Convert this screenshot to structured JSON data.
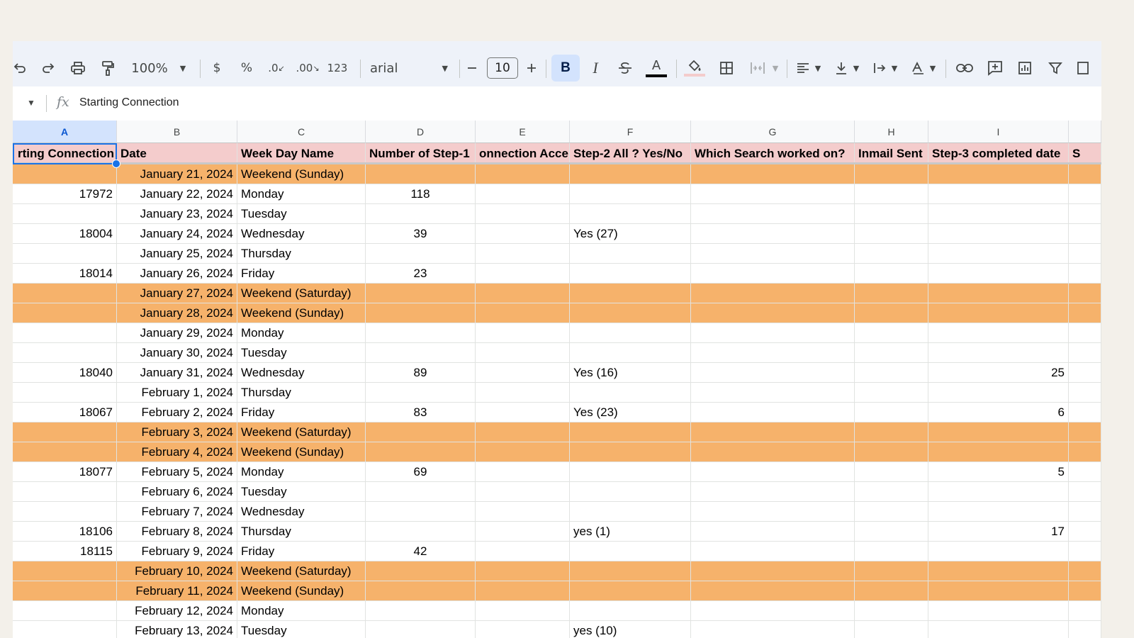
{
  "toolbar": {
    "zoom": "100%",
    "currency": "$",
    "percent": "%",
    "dec_decrease": ".0",
    "dec_increase": ".00",
    "number_format": "123",
    "font": "arial",
    "font_size": "10",
    "bold": "B",
    "italic": "I",
    "text_color": "A",
    "text_color_hex": "#000000"
  },
  "formula_bar": {
    "fx": "fx",
    "content": "Starting Connection"
  },
  "columns": [
    "A",
    "B",
    "C",
    "D",
    "E",
    "F",
    "G",
    "H",
    "I",
    ""
  ],
  "headers": [
    "rting Connection",
    "Date",
    "Week Day Name",
    "Number of Step-1",
    "onnection Acce",
    "Step-2 All ? Yes/No",
    "Which Search worked on?",
    "Inmail Sent",
    "Step-3 completed date",
    "S"
  ],
  "rows": [
    {
      "weekend": true,
      "cells": [
        "",
        "January 21, 2024",
        "Weekend (Sunday)",
        "",
        "",
        "",
        "",
        "",
        "",
        ""
      ]
    },
    {
      "weekend": false,
      "cells": [
        "17972",
        "January 22, 2024",
        "Monday",
        "118",
        "",
        "",
        "",
        "",
        "",
        ""
      ]
    },
    {
      "weekend": false,
      "cells": [
        "",
        "January 23, 2024",
        "Tuesday",
        "",
        "",
        "",
        "",
        "",
        "",
        ""
      ]
    },
    {
      "weekend": false,
      "cells": [
        "18004",
        "January 24, 2024",
        "Wednesday",
        "39",
        "",
        "Yes (27)",
        "",
        "",
        "",
        ""
      ]
    },
    {
      "weekend": false,
      "cells": [
        "",
        "January 25, 2024",
        "Thursday",
        "",
        "",
        "",
        "",
        "",
        "",
        ""
      ]
    },
    {
      "weekend": false,
      "cells": [
        "18014",
        "January 26, 2024",
        "Friday",
        "23",
        "",
        "",
        "",
        "",
        "",
        ""
      ]
    },
    {
      "weekend": true,
      "cells": [
        "",
        "January 27, 2024",
        "Weekend (Saturday)",
        "",
        "",
        "",
        "",
        "",
        "",
        ""
      ]
    },
    {
      "weekend": true,
      "cells": [
        "",
        "January 28, 2024",
        "Weekend (Sunday)",
        "",
        "",
        "",
        "",
        "",
        "",
        ""
      ]
    },
    {
      "weekend": false,
      "cells": [
        "",
        "January 29, 2024",
        "Monday",
        "",
        "",
        "",
        "",
        "",
        "",
        ""
      ]
    },
    {
      "weekend": false,
      "cells": [
        "",
        "January 30, 2024",
        "Tuesday",
        "",
        "",
        "",
        "",
        "",
        "",
        ""
      ]
    },
    {
      "weekend": false,
      "cells": [
        "18040",
        "January 31, 2024",
        "Wednesday",
        "89",
        "",
        "Yes (16)",
        "",
        "",
        "25",
        ""
      ]
    },
    {
      "weekend": false,
      "cells": [
        "",
        "February 1, 2024",
        "Thursday",
        "",
        "",
        "",
        "",
        "",
        "",
        ""
      ]
    },
    {
      "weekend": false,
      "cells": [
        "18067",
        "February 2, 2024",
        "Friday",
        "83",
        "",
        "Yes (23)",
        "",
        "",
        "6",
        ""
      ]
    },
    {
      "weekend": true,
      "cells": [
        "",
        "February 3, 2024",
        "Weekend (Saturday)",
        "",
        "",
        "",
        "",
        "",
        "",
        ""
      ]
    },
    {
      "weekend": true,
      "cells": [
        "",
        "February 4, 2024",
        "Weekend (Sunday)",
        "",
        "",
        "",
        "",
        "",
        "",
        ""
      ]
    },
    {
      "weekend": false,
      "cells": [
        "18077",
        "February 5, 2024",
        "Monday",
        "69",
        "",
        "",
        "",
        "",
        "5",
        ""
      ]
    },
    {
      "weekend": false,
      "cells": [
        "",
        "February 6, 2024",
        "Tuesday",
        "",
        "",
        "",
        "",
        "",
        "",
        ""
      ]
    },
    {
      "weekend": false,
      "cells": [
        "",
        "February 7, 2024",
        "Wednesday",
        "",
        "",
        "",
        "",
        "",
        "",
        ""
      ]
    },
    {
      "weekend": false,
      "cells": [
        "18106",
        "February 8, 2024",
        "Thursday",
        "",
        "",
        "yes (1)",
        "",
        "",
        "17",
        ""
      ]
    },
    {
      "weekend": false,
      "cells": [
        "18115",
        "February 9, 2024",
        "Friday",
        "42",
        "",
        "",
        "",
        "",
        "",
        ""
      ]
    },
    {
      "weekend": true,
      "cells": [
        "",
        "February 10, 2024",
        "Weekend (Saturday)",
        "",
        "",
        "",
        "",
        "",
        "",
        ""
      ]
    },
    {
      "weekend": true,
      "cells": [
        "",
        "February 11, 2024",
        "Weekend (Sunday)",
        "",
        "",
        "",
        "",
        "",
        "",
        ""
      ]
    },
    {
      "weekend": false,
      "cells": [
        "",
        "February 12, 2024",
        "Monday",
        "",
        "",
        "",
        "",
        "",
        "",
        ""
      ]
    },
    {
      "weekend": false,
      "cells": [
        "",
        "February 13, 2024",
        "Tuesday",
        "",
        "",
        "yes (10)",
        "",
        "",
        "",
        ""
      ]
    }
  ],
  "colors": {
    "weekend": "#f6b26b",
    "header": "#f4cccc",
    "selection": "#1a73e8"
  }
}
